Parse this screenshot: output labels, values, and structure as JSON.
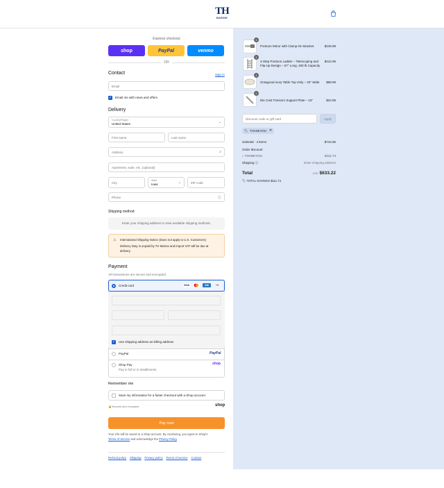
{
  "header": {
    "logo_text": "TH",
    "logo_sub": "MARINE",
    "cart_icon": "shopping-bag-icon"
  },
  "express": {
    "title": "Express checkout",
    "shop_label": "shop",
    "paypal_label": "PayPal",
    "venmo_label": "venmo",
    "or_label": "OR"
  },
  "contact": {
    "heading": "Contact",
    "sign_in": "Sign in",
    "email_placeholder": "Email",
    "news_label": "Email me with news and offers"
  },
  "delivery": {
    "heading": "Delivery",
    "country_label": "Country/Region",
    "country_value": "United States",
    "first_name": "First name",
    "last_name": "Last name",
    "address": "Address",
    "apartment": "Apartment, suite, etc. (optional)",
    "city": "City",
    "state_label": "State",
    "state_value": "Iowa",
    "zip": "ZIP code",
    "phone": "Phone"
  },
  "shipping": {
    "heading": "Shipping method",
    "message": "Enter your shipping address to view available shipping methods."
  },
  "notice": {
    "title": "International Shipping Notice (Does not apply to U.S. Customers)",
    "body_line1": "Delivery Duty is unpaid by TH Marine and import VAT will be due at",
    "body_line2": "delivery."
  },
  "payment": {
    "heading": "Payment",
    "subtitle": "All transactions are secure and encrypted.",
    "credit_card": "Credit card",
    "more_cards": "+3",
    "billing_label": "Use shipping address as billing address",
    "paypal_option": "PayPal",
    "paypal_logo": "PayPal",
    "shoppay_option": "Shop Pay",
    "shoppay_sub": "Pay in full or in installments",
    "shoppay_logo": "shop"
  },
  "remember": {
    "heading": "Remember me",
    "label": "Save my information for a faster checkout with a Shop account",
    "secure": "Secured and encrypted",
    "shop_logo": "shop"
  },
  "paynow": {
    "label": "Pay now",
    "legal_line1": "Your info will be saved to a Shop account. By continuing, you agree to Shop's",
    "legal_terms": "Terms of Service",
    "legal_mid": " and acknowledge the ",
    "legal_privacy": "Privacy Policy",
    "legal_end": "."
  },
  "footer": {
    "links": [
      "Refund policy",
      "Shipping",
      "Privacy policy",
      "Terms of service",
      "Contact"
    ]
  },
  "cart": {
    "items": [
      {
        "qty": "1",
        "name": "Pontoon Mirror with Clamp-On Bracket",
        "price": "$249.99"
      },
      {
        "qty": "1",
        "name": "4-Step Pontoon Ladder – Telescoping and Flip-Up Design – 57\" Long, 400 lb Capacity",
        "price": "$412.99"
      },
      {
        "qty": "1",
        "name": "Octagonal Ivory Table Top Only – 20\" Wide",
        "price": "$58.99"
      },
      {
        "qty": "1",
        "name": "Die Cast Transom Support Plate – 15\"",
        "price": "$22.99"
      }
    ],
    "discount_placeholder": "Discount code or gift card",
    "apply": "Apply",
    "code_tag": "THANKYOU"
  },
  "summary": {
    "subtotal_label": "Subtotal · 4 items",
    "subtotal_value": "$744.96",
    "order_discount": "Order discount",
    "discount_code": "THANKYOU",
    "discount_value": "-$111.74",
    "shipping_label": "Shipping",
    "shipping_value": "Enter shipping address",
    "total_label": "Total",
    "currency": "USD",
    "total_value": "$633.22",
    "savings_label": "TOTAL SAVINGS",
    "savings_value": "$111.74"
  },
  "colors": {
    "accent": "#1a5fd0",
    "shop_purple": "#5a31f4",
    "paypal_yellow": "#ffc439",
    "venmo_blue": "#008cff",
    "pay_orange": "#f7922b",
    "summary_bg": "#dfe8f6"
  }
}
